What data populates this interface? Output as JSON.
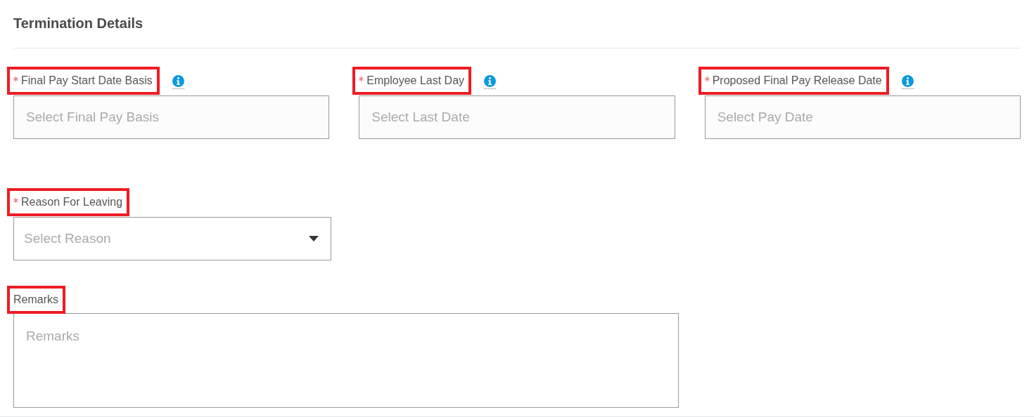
{
  "section": {
    "title": "Termination Details"
  },
  "rows": [
    {
      "fields": [
        {
          "kind": "input",
          "label": "Final Pay Start Date Basis",
          "required": true,
          "highlighted": true,
          "info": true,
          "placeholder": "Select Final Pay Basis"
        },
        {
          "kind": "input",
          "label": "Employee Last Day",
          "required": true,
          "highlighted": true,
          "info": true,
          "placeholder": "Select Last Date"
        },
        {
          "kind": "input",
          "label": "Proposed Final Pay Release Date",
          "required": true,
          "highlighted": true,
          "info": true,
          "placeholder": "Select Pay Date"
        }
      ]
    },
    {
      "fields": [
        {
          "kind": "select",
          "label": "Reason For Leaving",
          "required": true,
          "highlighted": true,
          "info": false,
          "placeholder": "Select Reason"
        }
      ]
    },
    {
      "fields": [
        {
          "kind": "textarea",
          "label": "Remarks",
          "required": false,
          "highlighted": true,
          "info": false,
          "placeholder": "Remarks"
        }
      ]
    }
  ]
}
